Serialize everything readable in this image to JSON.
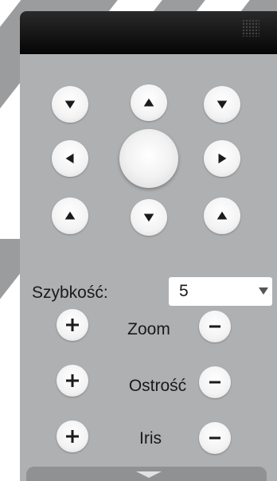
{
  "controls": {
    "speed_label": "Szybkość:",
    "speed_value": "5",
    "zoom_label": "Zoom",
    "focus_label": "Ostrość",
    "iris_label": "Iris"
  },
  "icons": {
    "direction_arrow": "triangle-arrow-icon",
    "increase": "plus-icon",
    "decrease": "minus-icon",
    "expand": "chevron-down-icon",
    "grip": "grip-icon"
  },
  "colors": {
    "panel_background": "#aeb0b2",
    "header_background": "#0a0a0a",
    "button_face": "#f5f5f5",
    "icon_color": "#1b1b1b"
  }
}
